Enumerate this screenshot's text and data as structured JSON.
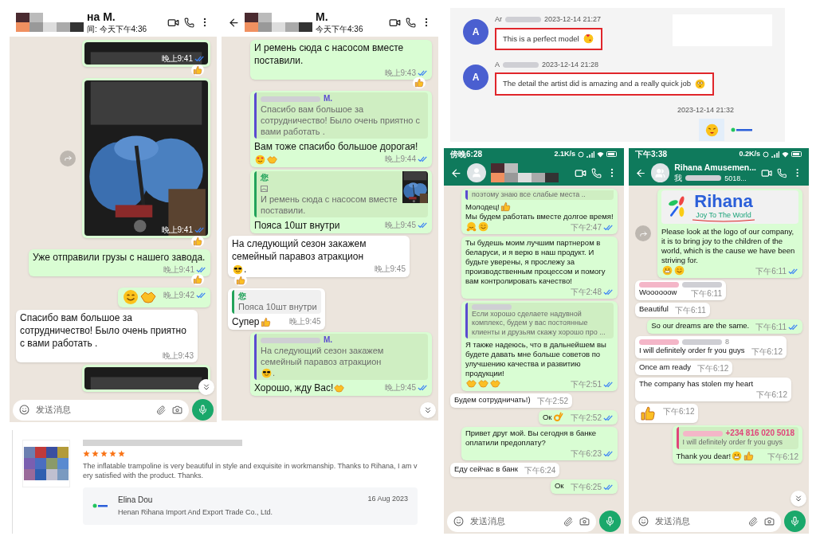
{
  "chat_a": {
    "header": {
      "kind": "light",
      "blurred_name": true,
      "title": "на М.",
      "subtitle": "间: 今天下午4:36"
    },
    "messages": [
      {
        "outgoing": true,
        "image": {
          "kind": "picture",
          "cut": true
        },
        "time": "晚上9:41",
        "read": true,
        "reaction": {
          "kind": "thumbs"
        }
      },
      {
        "outgoing": true,
        "forward": true,
        "image": {
          "kind": "picture",
          "cut": false
        },
        "time": "晚上9:41",
        "read": true,
        "reaction": {
          "kind": "thumbs"
        }
      },
      {
        "outgoing": true,
        "parts": [
          {
            "kind": "text",
            "text": "Уже отправили грузы с нашего завода."
          }
        ],
        "time": "晚上9:41",
        "read": true,
        "reaction": {
          "kind": "thumbs"
        }
      },
      {
        "outgoing": true,
        "parts": [
          {
            "kind": "smile"
          },
          {
            "kind": "handshake"
          }
        ],
        "time": "晚上9:42",
        "read": true
      },
      {
        "outgoing": false,
        "parts": [
          {
            "kind": "text",
            "text": "Спасибо вам большое за сотрудничество! Было очень приятно с вами работать ."
          }
        ],
        "time": "晚上9:43"
      },
      {
        "outgoing": true,
        "image": {
          "kind": "picture",
          "cut": true
        }
      }
    ],
    "scroll_button": true,
    "input": {
      "placeholder": "发送消息"
    }
  },
  "chat_b": {
    "header": {
      "kind": "light",
      "back": true,
      "blurred_name": true,
      "title": "М.",
      "subtitle": "今天下午4:36"
    },
    "messages": [
      {
        "outgoing": true,
        "parts": [
          {
            "kind": "text",
            "text": "И ремень сюда с насосом вместе поставили."
          }
        ],
        "time": "晚上9:43",
        "read": true,
        "reaction": {
          "kind": "thumbs"
        }
      },
      {
        "outgoing": true,
        "quote": {
          "author": "М.",
          "author_blurred": true,
          "color": "#5b4bd0",
          "parts": [
            {
              "kind": "text",
              "text": "Спасибо вам большое за сотрудничество! Было очень приятно с вами работать ."
            }
          ]
        },
        "parts": [
          {
            "kind": "text",
            "text": "Вам тоже спасибо большое дорогая!"
          },
          {
            "kind": "love"
          },
          {
            "kind": "handshake"
          }
        ],
        "time": "晚上9:44",
        "read": true
      },
      {
        "outgoing": true,
        "quote": {
          "author": "您",
          "color": "#22a35a",
          "photo": true,
          "parts": [
            {
              "kind": "text",
              "text": "И ремень сюда с насосом вместе поставили."
            }
          ]
        },
        "parts": [
          {
            "kind": "text",
            "text": "Пояса 10шт внутри"
          }
        ],
        "time": "晚上9:45",
        "read": true
      },
      {
        "outgoing": false,
        "parts": [
          {
            "kind": "text",
            "text": "На следующий сезон закажем семейный паравоз атракцион"
          },
          {
            "kind": "cool"
          },
          {
            "kind": "text",
            "text": "."
          }
        ],
        "time": "晚上9:45",
        "reaction": {
          "kind": "thumbs"
        }
      },
      {
        "outgoing": false,
        "quote": {
          "author": "您",
          "color": "#22a35a",
          "parts": [
            {
              "kind": "text",
              "text": "Пояса 10шт внутри"
            }
          ]
        },
        "parts": [
          {
            "kind": "text",
            "text": "Супер"
          },
          {
            "kind": "thumbs"
          }
        ],
        "time": "晚上9:45"
      },
      {
        "outgoing": true,
        "quote": {
          "author": "М.",
          "author_blurred": true,
          "color": "#5b4bd0",
          "parts": [
            {
              "kind": "text",
              "text": "На следующий сезон закажем семейный паравоз атракцион"
            },
            {
              "kind": "cool"
            },
            {
              "kind": "text",
              "text": "."
            }
          ]
        },
        "parts": [
          {
            "kind": "text",
            "text": "Хорошо, жду Вас!"
          },
          {
            "kind": "handshake"
          }
        ],
        "time": "晚上9:45",
        "read": true
      }
    ],
    "scroll_button": true
  },
  "web_chat": {
    "messages": [
      {
        "outgoing": false,
        "avatar": "A",
        "name": "Ar",
        "time": "2023-12-14 21:27",
        "text": "This is a perfect model",
        "emoji": {
          "kind": "kiss"
        },
        "highlighted": true
      },
      {
        "outgoing": false,
        "avatar": "A",
        "name": "A",
        "time": "2023-12-14 21:28",
        "text": "The detail the artist did is amazing and a really quick job",
        "emoji": {
          "kind": "blush"
        },
        "highlighted": true
      },
      {
        "outgoing": true,
        "time": "2023-12-14 21:32",
        "sticker": {
          "kind": "tongue"
        }
      }
    ]
  },
  "chat_d": {
    "status_bar": {
      "time": "傍晚6:28",
      "speed": "2.1K/s"
    },
    "header": {
      "kind": "dark",
      "back": true,
      "avatar": {
        "kind": "person"
      },
      "blurred_name": true
    },
    "messages": [
      {
        "outgoing": true,
        "quote": {
          "color": "#5b4bd0",
          "cut": true,
          "parts": [
            {
              "kind": "text",
              "text": "поэтому знаю все слабые места .."
            }
          ]
        },
        "parts": [
          {
            "kind": "text",
            "text": "Молодец!"
          },
          {
            "kind": "thumbs"
          },
          {
            "kind": "text",
            "text": " Мы будем работать вместе долгое время!"
          },
          {
            "kind": "hug"
          },
          {
            "kind": "smile"
          }
        ],
        "time": "下午2:47",
        "read": true
      },
      {
        "outgoing": true,
        "parts": [
          {
            "kind": "text",
            "text": "Ты будешь моим лучшим партнером в беларуси, и я верю в наш продукт. И будьте уверены, я прослежу за производственным процессом и помогу вам контролировать качество!"
          }
        ],
        "time": "下午2:48",
        "read": true
      },
      {
        "outgoing": true,
        "quote": {
          "author_blurred": true,
          "color": "#5b4bd0",
          "parts": [
            {
              "kind": "text",
              "text": "Если хорошо сделаете надувной комплекс, будем у вас постоянные клиенты и друзьям скажу хорошо про ..."
            }
          ]
        },
        "parts": [
          {
            "kind": "text",
            "text": "Я также надеюсь, что в дальнейшем вы будете давать мне больше советов по улучшению качества и развитию продукции!"
          },
          {
            "kind": "handshake"
          },
          {
            "kind": "handshake"
          },
          {
            "kind": "handshake"
          }
        ],
        "time": "下午2:51",
        "read": true
      },
      {
        "outgoing": false,
        "parts": [
          {
            "kind": "text",
            "text": "Будем сотрудничать!)"
          }
        ],
        "time": "下午2:52"
      },
      {
        "outgoing": true,
        "parts": [
          {
            "kind": "text",
            "text": "Ок"
          },
          {
            "kind": "ok"
          }
        ],
        "time": "下午2:52",
        "read": true
      },
      {
        "outgoing": true,
        "parts": [
          {
            "kind": "text",
            "text": "Привет друг мой.  Вы сегодня в банке оплатили предоплату?"
          }
        ],
        "time": "下午6:23",
        "read": true
      },
      {
        "outgoing": false,
        "parts": [
          {
            "kind": "text",
            "text": "Еду сейчас в банк"
          }
        ],
        "time": "下午6:24"
      },
      {
        "outgoing": true,
        "parts": [
          {
            "kind": "text",
            "text": "Ок"
          }
        ],
        "time": "下午6:25",
        "read": true
      }
    ],
    "input": {
      "placeholder": "发送消息"
    }
  },
  "chat_e": {
    "status_bar": {
      "time": "下午3:38",
      "speed": "0.2K/s"
    },
    "header": {
      "kind": "dark",
      "back": true,
      "avatar": {
        "kind": "group"
      },
      "title": "Rihana Amusemen...",
      "subtitle": "我",
      "subtitle_tail": "5018..."
    },
    "messages": [
      {
        "outgoing": true,
        "forward": true,
        "image": {
          "kind": "logo",
          "brand": "Rihana",
          "tagline": "Joy To The World"
        },
        "parts": [
          {
            "kind": "text",
            "text": "Please look at the logo of our company, it is to bring joy to the children of the world, which is the cause we have been striving for."
          },
          {
            "kind": "grin"
          },
          {
            "kind": "smile"
          }
        ],
        "time": "下午6:11",
        "read": true
      },
      {
        "outgoing": false,
        "sender_blurred": true,
        "parts": [
          {
            "kind": "text",
            "text": "Woooooow"
          }
        ],
        "time": "下午6:11"
      },
      {
        "outgoing": false,
        "parts": [
          {
            "kind": "text",
            "text": "Beautiful"
          }
        ],
        "time": "下午6:11"
      },
      {
        "outgoing": true,
        "parts": [
          {
            "kind": "text",
            "text": "So our dreams are the same."
          }
        ],
        "time": "下午6:11",
        "read": true
      },
      {
        "outgoing": false,
        "sender_blurred": true,
        "sender_tail": "8",
        "parts": [
          {
            "kind": "text",
            "text": "I will definitely order fr you guys"
          }
        ],
        "time": "下午6:12"
      },
      {
        "outgoing": false,
        "parts": [
          {
            "kind": "text",
            "text": "Once am ready"
          }
        ],
        "time": "下午6:12"
      },
      {
        "outgoing": false,
        "parts": [
          {
            "kind": "text",
            "text": "The company has stolen my heart"
          }
        ],
        "time": "下午6:12"
      },
      {
        "outgoing": false,
        "parts": [
          {
            "kind": "thumbs"
          }
        ],
        "time": "下午6:12"
      },
      {
        "outgoing": true,
        "quote": {
          "author": "+234 816 020 5018",
          "author_blurred": true,
          "color": "#e0457b",
          "parts": [
            {
              "kind": "text",
              "text": "I will definitely order fr you guys"
            }
          ]
        },
        "parts": [
          {
            "kind": "text",
            "text": "Thank you dear!"
          },
          {
            "kind": "grin"
          },
          {
            "kind": "thumbs"
          }
        ],
        "time": "下午6:12"
      }
    ],
    "scroll_button": true,
    "input": {
      "placeholder": "发送消息"
    }
  },
  "review": {
    "title_blurred": true,
    "stars": 5,
    "text": "The inflatable trampoline is very beautiful in style and exquisite in workmanship. Thanks to Rihana, I am very satisfied with the product. Thanks.",
    "reply": {
      "name": "Elina Dou",
      "company": "Henan Rihana Import And Export Trade Co., Ltd.",
      "date": "16 Aug 2023"
    }
  }
}
